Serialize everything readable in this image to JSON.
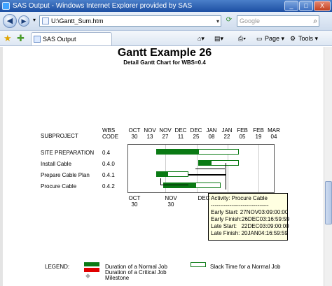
{
  "window": {
    "title": "SAS Output - Windows Internet Explorer provided by SAS",
    "min": "_",
    "max": "□",
    "close": "X"
  },
  "address": {
    "url": "U:\\Gantt_Sum.htm"
  },
  "search": {
    "placeholder": "Google"
  },
  "tab": {
    "label": "SAS Output"
  },
  "commands": {
    "page": "Page",
    "tools": "Tools"
  },
  "report": {
    "title": "Gantt Example 26",
    "subtitle": "Detail Gantt Chart for WBS=0.4"
  },
  "headers": {
    "subproject": "SUBPROJECT",
    "wbs_line1": "WBS",
    "wbs_line2": "CODE"
  },
  "top_ticks": [
    {
      "m": "OCT",
      "d": "30"
    },
    {
      "m": "NOV",
      "d": "13"
    },
    {
      "m": "NOV",
      "d": "27"
    },
    {
      "m": "DEC",
      "d": "11"
    },
    {
      "m": "DEC",
      "d": "25"
    },
    {
      "m": "JAN",
      "d": "08"
    },
    {
      "m": "JAN",
      "d": "22"
    },
    {
      "m": "FEB",
      "d": "05"
    },
    {
      "m": "FEB",
      "d": "19"
    },
    {
      "m": "MAR",
      "d": "04"
    }
  ],
  "bottom_ticks": [
    {
      "m": "OCT",
      "d": "30"
    },
    {
      "m": "NOV",
      "d": "30"
    },
    {
      "m": "DEC",
      "d": ""
    }
  ],
  "rows": [
    {
      "name": "SITE PREPARATION",
      "wbs": "0.4"
    },
    {
      "name": "Install Cable",
      "wbs": "0.4.0"
    },
    {
      "name": "Prepare Cable Plan",
      "wbs": "0.4.1"
    },
    {
      "name": "Procure Cable",
      "wbs": "0.4.2"
    }
  ],
  "tooltip": {
    "text": "Activity: Procure Cable\n-------------------------------\nEarly Start: 27NOV03:09:00:00\nEarly Finish:26DEC03:16:59:59\nLate Start:   22DEC03:09:00:00\nLate Finish: 20JAN04:16:59:59"
  },
  "legend": {
    "label": "LEGEND:",
    "normal": "Duration of a Normal Job",
    "critical": "Duration of a Critical Job",
    "milestone": "Milestone",
    "slack": "Slack Time for a Normal Job"
  },
  "colors": {
    "normal": "#0a7a14",
    "critical": "#e00000",
    "milestone": "#bbbbbb"
  }
}
